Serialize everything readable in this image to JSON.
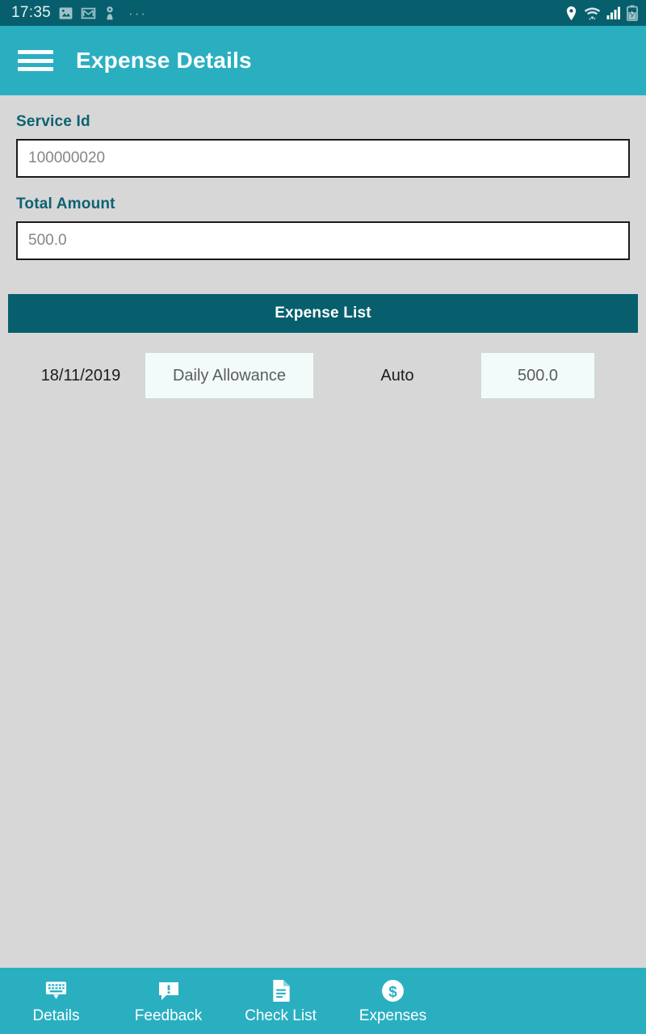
{
  "status_bar": {
    "clock": "17:35",
    "overflow_dots": "···",
    "left_icons": [
      "image-notification-icon",
      "gmail-notification-icon",
      "app-notification-icon"
    ],
    "right_icons": [
      "location-pin-icon",
      "wifi-icon",
      "cellular-signal-icon",
      "battery-charging-icon"
    ],
    "background_color": "#075f6d"
  },
  "app_bar": {
    "title": "Expense Details",
    "menu_icon": "hamburger-menu-icon",
    "background_color": "#2aafc1"
  },
  "form": {
    "service_id": {
      "label": "Service Id",
      "value": "100000020"
    },
    "total_amount": {
      "label": "Total Amount",
      "value": "500.0"
    }
  },
  "expense_list": {
    "header": "Expense List",
    "header_color": "#075f6d",
    "rows": [
      {
        "date": "18/11/2019",
        "type": "Daily Allowance",
        "mode": "Auto",
        "amount": "500.0"
      }
    ]
  },
  "bottom_nav": {
    "background_color": "#2aafc1",
    "items": [
      {
        "label": "Details",
        "icon": "keyboard-icon"
      },
      {
        "label": "Feedback",
        "icon": "feedback-bubble-icon"
      },
      {
        "label": "Check List",
        "icon": "document-icon"
      },
      {
        "label": "Expenses",
        "icon": "dollar-circle-icon"
      }
    ]
  },
  "theme": {
    "page_background": "#d7d7d7",
    "label_color": "#0c6272",
    "accent": "#2aafc1",
    "dark_accent": "#075f6d",
    "cell_background": "#f2fbfa"
  }
}
